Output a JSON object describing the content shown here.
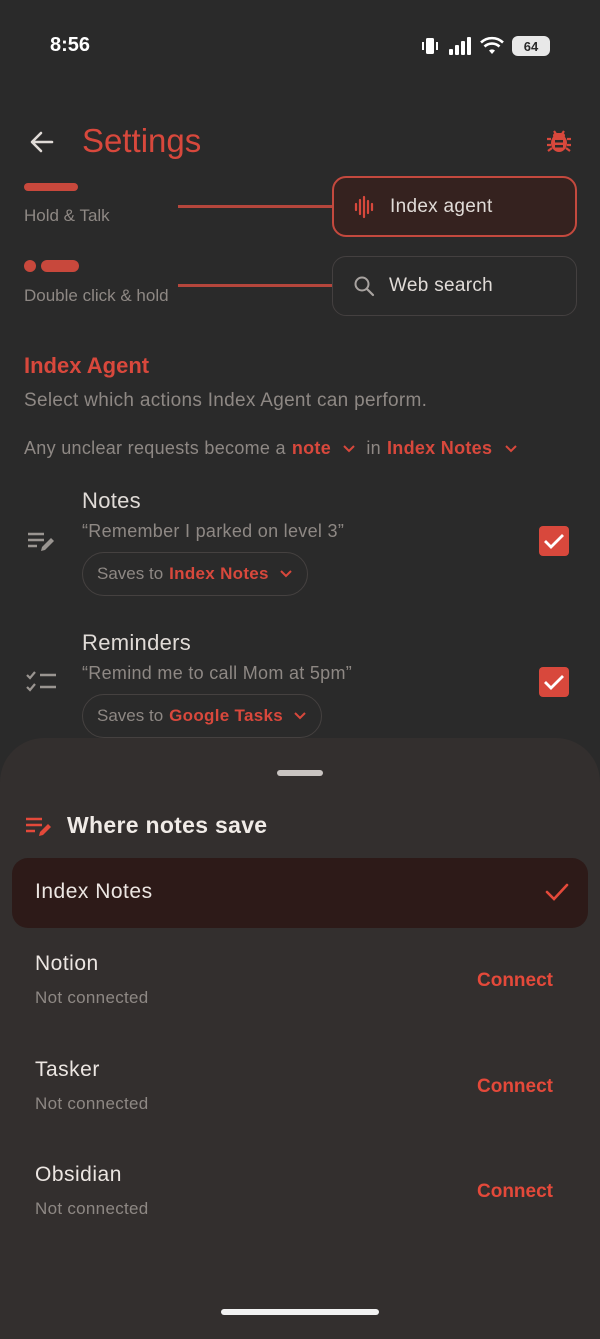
{
  "status_bar": {
    "time": "8:56",
    "battery": "64"
  },
  "header": {
    "title": "Settings"
  },
  "gestures": [
    {
      "label": "Hold & Talk",
      "chip": "Index agent",
      "chip_icon": "waveform-icon",
      "active": true
    },
    {
      "label": "Double click & hold",
      "chip": "Web search",
      "chip_icon": "search-icon",
      "active": false
    }
  ],
  "section": {
    "title": "Index Agent",
    "subtitle": "Select which actions Index Agent can perform.",
    "unclear_prefix": "Any unclear requests become a",
    "unclear_type": "note",
    "unclear_in": "in",
    "unclear_target": "Index Notes"
  },
  "actions": [
    {
      "title": "Notes",
      "quote": "“Remember I parked on level 3”",
      "saves_prefix": "Saves to",
      "saves_target": "Index Notes",
      "checked": true
    },
    {
      "title": "Reminders",
      "quote": "“Remind me to call Mom at 5pm”",
      "saves_prefix": "Saves to",
      "saves_target": "Google Tasks",
      "checked": true
    }
  ],
  "sheet": {
    "title": "Where notes save",
    "selected": "Index Notes",
    "options": [
      {
        "name": "Notion",
        "status": "Not connected",
        "action": "Connect"
      },
      {
        "name": "Tasker",
        "status": "Not connected",
        "action": "Connect"
      },
      {
        "name": "Obsidian",
        "status": "Not connected",
        "action": "Connect"
      }
    ]
  },
  "colors": {
    "accent": "#d8483c",
    "background": "#2a2a2a",
    "sheet": "#332f2e",
    "selected": "#2d1a18"
  }
}
